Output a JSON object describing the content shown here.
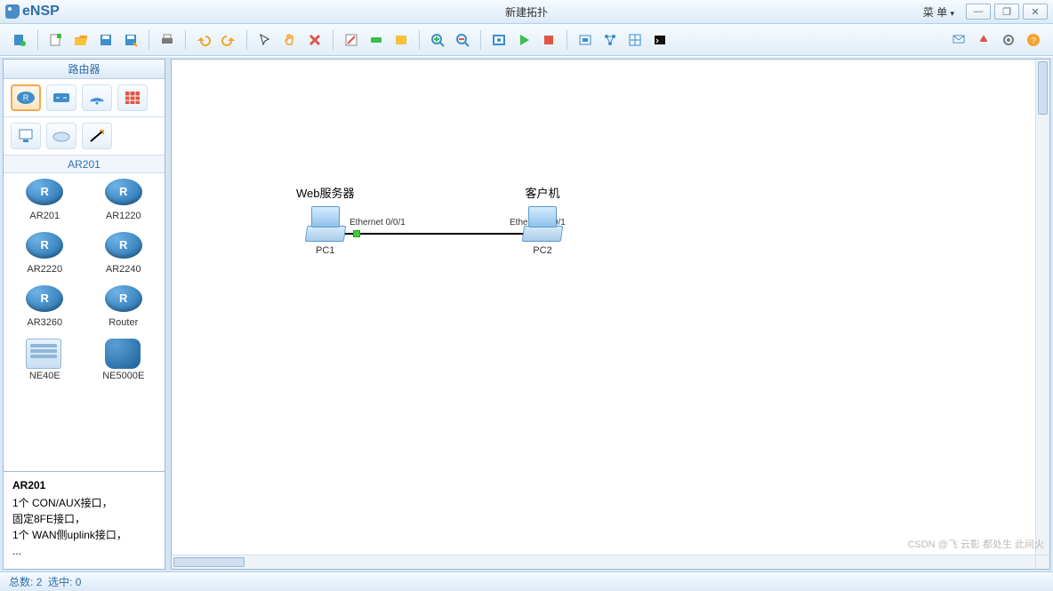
{
  "app": {
    "name": "eNSP",
    "title": "新建拓扑",
    "menu_label": "菜  单"
  },
  "sidebar": {
    "header": "路由器",
    "sub_header": "AR201",
    "devices": [
      {
        "label": "AR201"
      },
      {
        "label": "AR1220"
      },
      {
        "label": "AR2220"
      },
      {
        "label": "AR2240"
      },
      {
        "label": "AR3260"
      },
      {
        "label": "Router"
      },
      {
        "label": "NE40E"
      },
      {
        "label": "NE5000E"
      }
    ],
    "info": {
      "title": "AR201",
      "line1": "1个 CON/AUX接口，",
      "line2": "固定8FE接口，",
      "line3": "1个 WAN侧uplink接口，",
      "line4": "..."
    }
  },
  "topology": {
    "node1": {
      "title": "Web服务器",
      "label": "PC1",
      "port": "Ethernet 0/0/1"
    },
    "node2": {
      "title": "客户机",
      "label": "PC2",
      "port": "Ethernet 0/0/1"
    }
  },
  "status": {
    "total_label": "总数:",
    "total": "2",
    "sel_label": "选中:",
    "sel": "0"
  },
  "watermark": "CSDN @飞 云影 都处生 此间火"
}
